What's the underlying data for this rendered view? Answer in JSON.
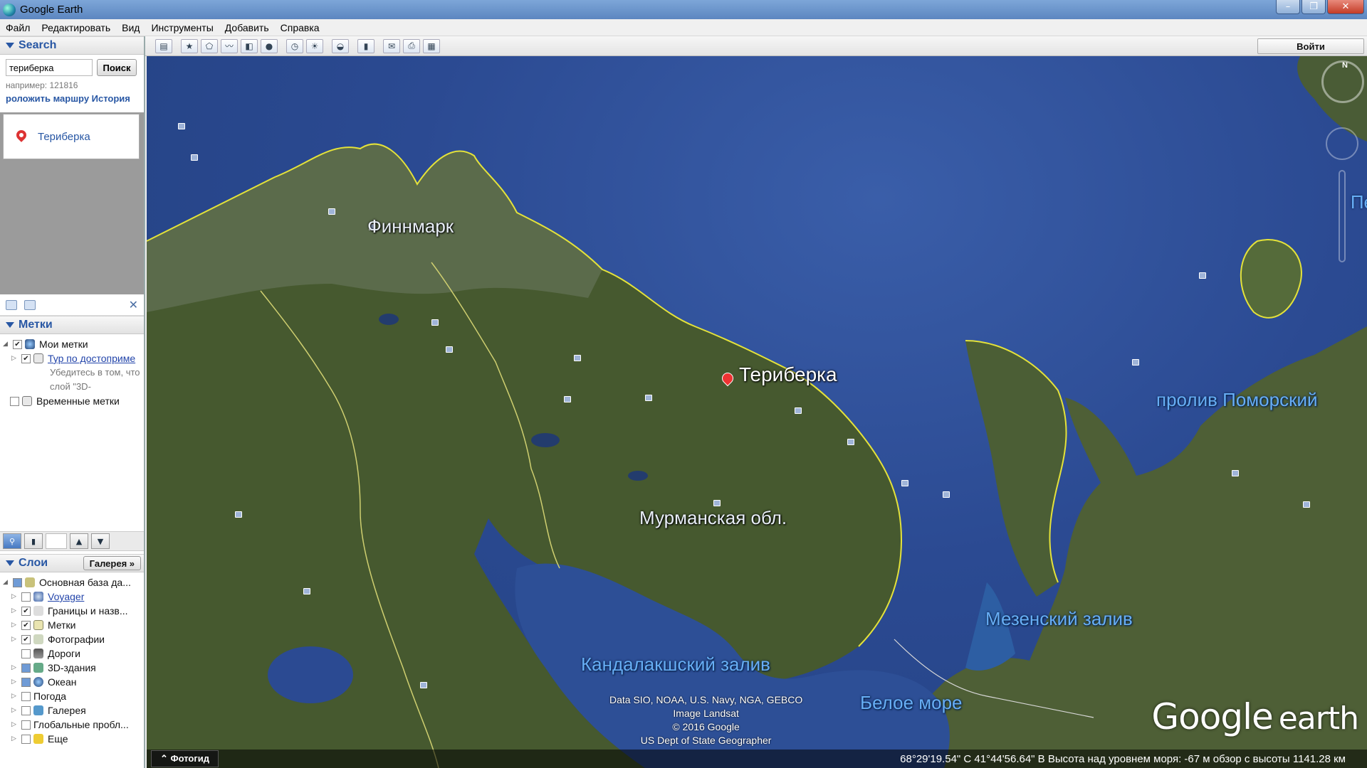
{
  "window": {
    "title": "Google Earth",
    "buttons": [
      "–",
      "❐",
      "✕"
    ]
  },
  "menu": [
    "Файл",
    "Редактировать",
    "Вид",
    "Инструменты",
    "Добавить",
    "Справка"
  ],
  "search": {
    "header": "Search",
    "value": "териберка",
    "button": "Поиск",
    "hint": "например: 121816",
    "links": "роложить маршру История",
    "result": "Териберка"
  },
  "places": {
    "header": "Метки",
    "close": "✕",
    "items": {
      "my_places": "Мои метки",
      "tour": "Тур по достоприме",
      "note": "Убедитесь в том, что слой \"3D-",
      "temp": "Временные метки"
    }
  },
  "layers": {
    "header": "Слои",
    "gallery_button": "Галерея »",
    "items": {
      "base": "Основная база да...",
      "voyager": "Voyager",
      "borders": "Границы и назв...",
      "places": "Метки",
      "photos": "Фотографии",
      "roads": "Дороги",
      "buildings": "3D-здания",
      "ocean": "Океан",
      "weather": "Погода",
      "gallery": "Галерея",
      "global": "Глобальные пробл...",
      "more": "Еще"
    }
  },
  "toolbar": {
    "login": "Войти"
  },
  "map": {
    "labels": {
      "finnmark": "Финнмарк",
      "teriberka": "Териберка",
      "murmansk": "Мурманская обл.",
      "pomorsky": "пролив Поморский",
      "mezen": "Мезенский залив",
      "kandalaksha": "Кандалакшский залив",
      "white_sea": "Белое море",
      "peek": "Пе"
    },
    "attribution": [
      "Data SIO, NOAA, U.S. Navy, NGA, GEBCO",
      "Image Landsat",
      "© 2016 Google",
      "US Dept of State Geographer"
    ],
    "logo_google": "Google",
    "logo_earth": "earth",
    "compass_n": "N",
    "photoguide": "⌃ Фотогид",
    "status": "68°29'19.54\" С   41°44'56.64\" В  Высота над уровнем моря:   -67 м     обзор с высоты 1141.28 км"
  },
  "colors": {
    "accent": "#2857a4",
    "water": "#2b4a92",
    "land": "#4b5e35",
    "border": "#e4e23a"
  }
}
